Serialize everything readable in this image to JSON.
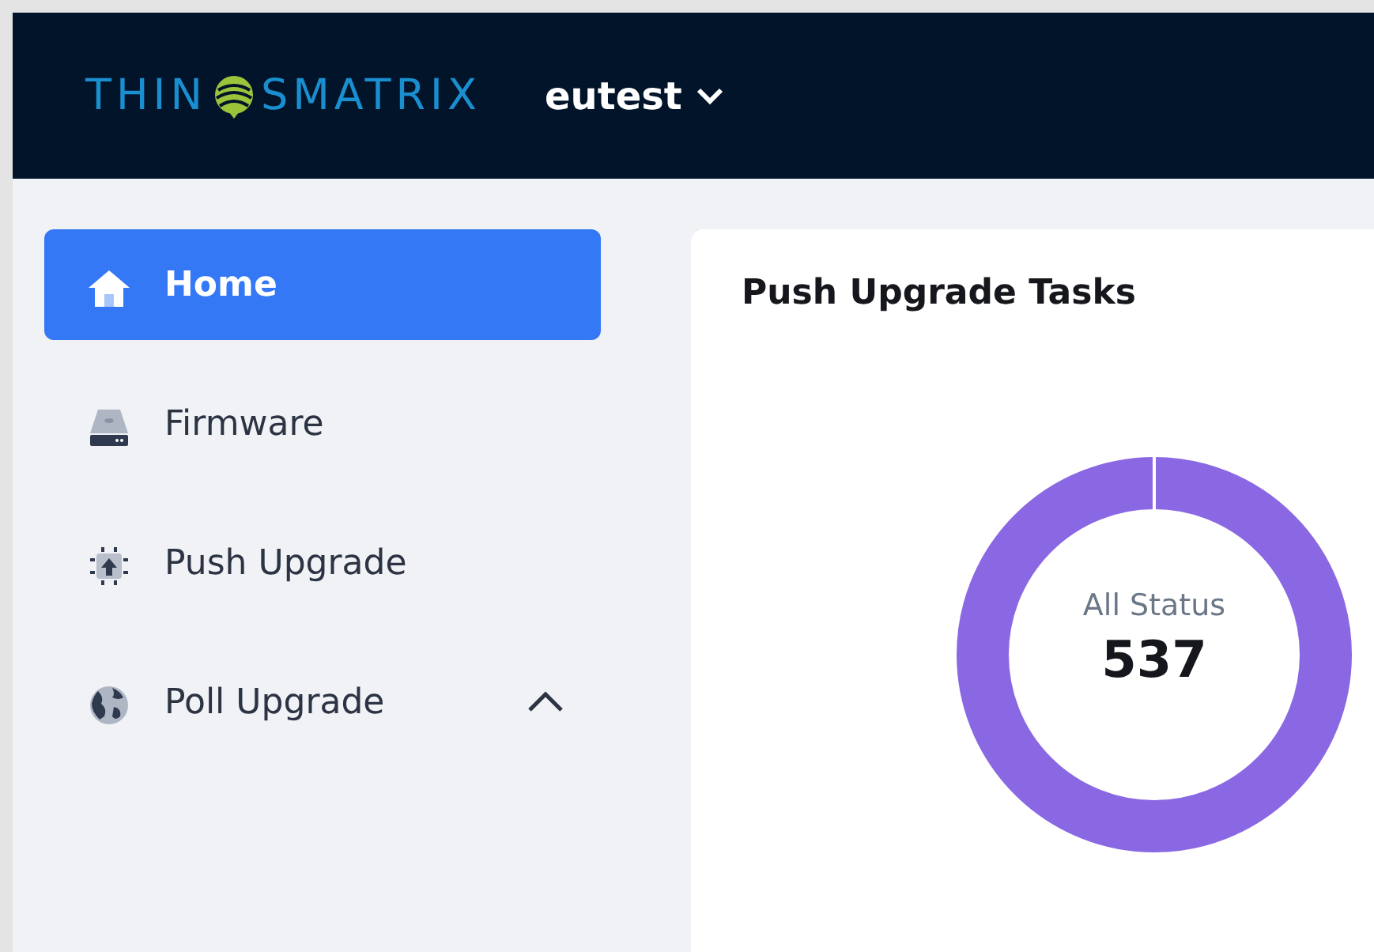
{
  "header": {
    "logo_left": "THIN",
    "logo_right": "SMATRIX",
    "account": "eutest"
  },
  "sidebar": {
    "items": [
      {
        "label": "Home",
        "selected": true
      },
      {
        "label": "Firmware",
        "selected": false
      },
      {
        "label": "Push Upgrade",
        "selected": false
      },
      {
        "label": "Poll Upgrade",
        "selected": false,
        "expanded": true
      }
    ]
  },
  "card": {
    "title": "Push Upgrade Tasks",
    "donut_label": "All Status",
    "donut_total": "537"
  }
}
